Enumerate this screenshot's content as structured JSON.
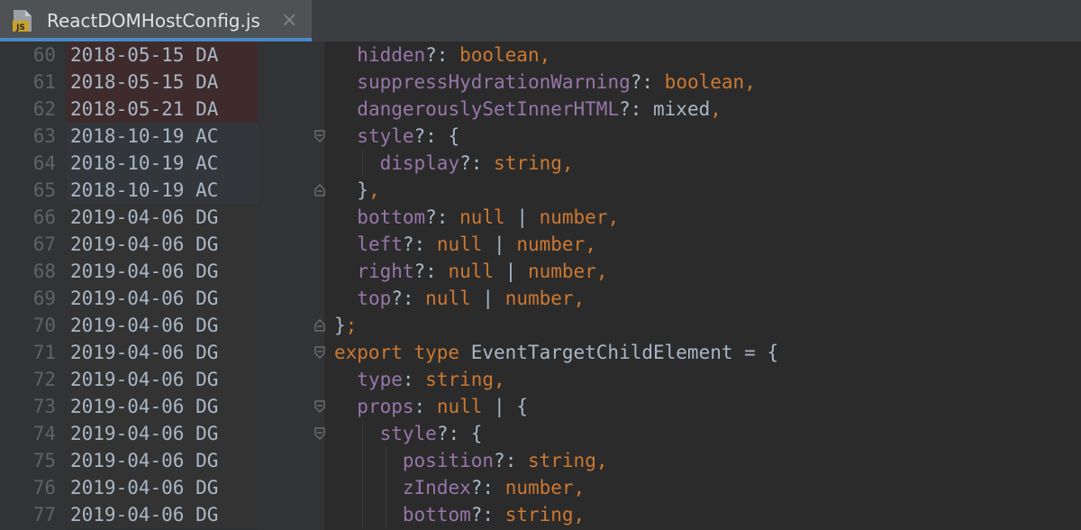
{
  "tab": {
    "file_name": "ReactDOMHostConfig.js",
    "icon_badge": "JS",
    "close_glyph": "×"
  },
  "colors": {
    "prop": "#9876aa",
    "keyword": "#cc7832",
    "plain": "#a9b7c6",
    "annot_da": "#3f2b2b",
    "annot_ac": "#33363b",
    "annot_dg": "#333333"
  },
  "lines": [
    {
      "no": "60",
      "ann": "2018-05-15 DA",
      "group": "da",
      "indent": 1,
      "tokens": [
        [
          "prop",
          "hidden"
        ],
        [
          "pl",
          "?: "
        ],
        [
          "kw",
          "boolean"
        ],
        [
          "kw",
          ","
        ]
      ]
    },
    {
      "no": "61",
      "ann": "2018-05-15 DA",
      "group": "da",
      "indent": 1,
      "tokens": [
        [
          "prop",
          "suppressHydrationWarning"
        ],
        [
          "pl",
          "?: "
        ],
        [
          "kw",
          "boolean"
        ],
        [
          "kw",
          ","
        ]
      ]
    },
    {
      "no": "62",
      "ann": "2018-05-21 DA",
      "group": "da",
      "indent": 1,
      "tokens": [
        [
          "prop",
          "dangerouslySetInnerHTML"
        ],
        [
          "pl",
          "?: mixed"
        ],
        [
          "kw",
          ","
        ]
      ]
    },
    {
      "no": "63",
      "ann": "2018-10-19 AC",
      "group": "ac",
      "indent": 1,
      "fold": "open",
      "tokens": [
        [
          "prop",
          "style"
        ],
        [
          "pl",
          "?: {"
        ]
      ]
    },
    {
      "no": "64",
      "ann": "2018-10-19 AC",
      "group": "ac",
      "indent": 2,
      "tokens": [
        [
          "prop",
          "display"
        ],
        [
          "pl",
          "?: "
        ],
        [
          "kw",
          "string"
        ],
        [
          "kw",
          ","
        ]
      ]
    },
    {
      "no": "65",
      "ann": "2018-10-19 AC",
      "group": "ac",
      "indent": 1,
      "fold": "close",
      "tokens": [
        [
          "pl",
          "}"
        ],
        [
          "kw",
          ","
        ]
      ]
    },
    {
      "no": "66",
      "ann": "2019-04-06 DG",
      "group": "dg",
      "indent": 1,
      "tokens": [
        [
          "prop",
          "bottom"
        ],
        [
          "pl",
          "?: "
        ],
        [
          "kw",
          "null"
        ],
        [
          "pl",
          " | "
        ],
        [
          "kw",
          "number"
        ],
        [
          "kw",
          ","
        ]
      ]
    },
    {
      "no": "67",
      "ann": "2019-04-06 DG",
      "group": "dg",
      "indent": 1,
      "tokens": [
        [
          "prop",
          "left"
        ],
        [
          "pl",
          "?: "
        ],
        [
          "kw",
          "null"
        ],
        [
          "pl",
          " | "
        ],
        [
          "kw",
          "number"
        ],
        [
          "kw",
          ","
        ]
      ]
    },
    {
      "no": "68",
      "ann": "2019-04-06 DG",
      "group": "dg",
      "indent": 1,
      "tokens": [
        [
          "prop",
          "right"
        ],
        [
          "pl",
          "?: "
        ],
        [
          "kw",
          "null"
        ],
        [
          "pl",
          " | "
        ],
        [
          "kw",
          "number"
        ],
        [
          "kw",
          ","
        ]
      ]
    },
    {
      "no": "69",
      "ann": "2019-04-06 DG",
      "group": "dg",
      "indent": 1,
      "tokens": [
        [
          "prop",
          "top"
        ],
        [
          "pl",
          "?: "
        ],
        [
          "kw",
          "null"
        ],
        [
          "pl",
          " | "
        ],
        [
          "kw",
          "number"
        ],
        [
          "kw",
          ","
        ]
      ]
    },
    {
      "no": "70",
      "ann": "2019-04-06 DG",
      "group": "dg",
      "indent": 0,
      "fold": "close",
      "tokens": [
        [
          "pl",
          "}"
        ],
        [
          "kw",
          ";"
        ]
      ]
    },
    {
      "no": "71",
      "ann": "2019-04-06 DG",
      "group": "dg",
      "indent": 0,
      "fold": "open",
      "tokens": [
        [
          "kw",
          "export type "
        ],
        [
          "pl",
          "EventTargetChildElement = {"
        ]
      ]
    },
    {
      "no": "72",
      "ann": "2019-04-06 DG",
      "group": "dg",
      "indent": 1,
      "tokens": [
        [
          "prop",
          "type"
        ],
        [
          "pl",
          ": "
        ],
        [
          "kw",
          "string"
        ],
        [
          "kw",
          ","
        ]
      ]
    },
    {
      "no": "73",
      "ann": "2019-04-06 DG",
      "group": "dg",
      "indent": 1,
      "fold": "open",
      "tokens": [
        [
          "prop",
          "props"
        ],
        [
          "pl",
          ": "
        ],
        [
          "kw",
          "null"
        ],
        [
          "pl",
          " | {"
        ]
      ]
    },
    {
      "no": "74",
      "ann": "2019-04-06 DG",
      "group": "dg",
      "indent": 2,
      "fold": "open",
      "tokens": [
        [
          "prop",
          "style"
        ],
        [
          "pl",
          "?: {"
        ]
      ]
    },
    {
      "no": "75",
      "ann": "2019-04-06 DG",
      "group": "dg",
      "indent": 3,
      "tokens": [
        [
          "prop",
          "position"
        ],
        [
          "pl",
          "?: "
        ],
        [
          "kw",
          "string"
        ],
        [
          "kw",
          ","
        ]
      ]
    },
    {
      "no": "76",
      "ann": "2019-04-06 DG",
      "group": "dg",
      "indent": 3,
      "tokens": [
        [
          "prop",
          "zIndex"
        ],
        [
          "pl",
          "?: "
        ],
        [
          "kw",
          "number"
        ],
        [
          "kw",
          ","
        ]
      ]
    },
    {
      "no": "77",
      "ann": "2019-04-06 DG",
      "group": "dg",
      "indent": 3,
      "tokens": [
        [
          "prop",
          "bottom"
        ],
        [
          "pl",
          "?: "
        ],
        [
          "kw",
          "string"
        ],
        [
          "kw",
          ","
        ]
      ]
    }
  ]
}
